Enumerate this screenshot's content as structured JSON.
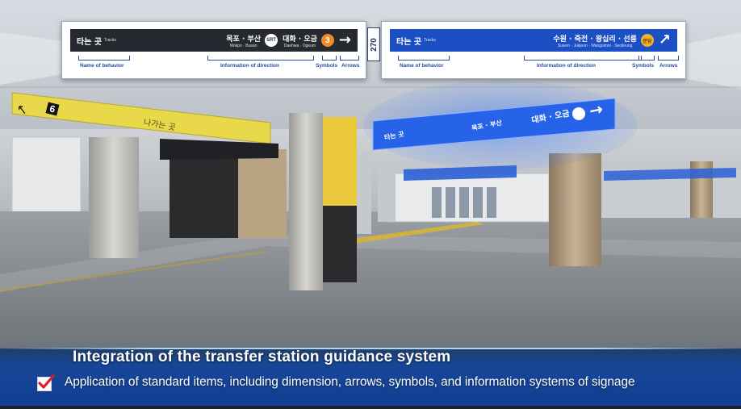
{
  "diagram": {
    "left_sign": {
      "behavior_ko": "타는 곳",
      "behavior_en": "Tracks",
      "destinations": [
        {
          "ko": "목포 · 부산",
          "en": "Mokpo · Busan"
        },
        {
          "ko": "대화 · 오금",
          "en": "Daehwa · Ogeum"
        }
      ],
      "symbols": [
        "SRT",
        "3"
      ],
      "arrow": "→"
    },
    "right_sign": {
      "behavior_ko": "타는 곳",
      "behavior_en": "Tracks",
      "destinations": [
        {
          "ko": "수원 · 죽전 · 왕십리 · 선릉",
          "en": "Suwon · Jukjeon · Wangsimni · Seolleung"
        }
      ],
      "symbols": [
        "분당"
      ],
      "arrow": "↗"
    },
    "side_number": "270",
    "captions": {
      "name_of_behavior": "Name of behavior",
      "information_of_direction": "Information of direction",
      "symbols": "Symbols",
      "arrows": "Arrows"
    }
  },
  "scene_signs": {
    "yellow_number": "6",
    "yellow_text": "나가는 곳",
    "blue_behavior": "타는 곳",
    "blue_dest_1": "목포 · 부산",
    "blue_dest_2": "대화 · 오금",
    "blue_arrow": "→"
  },
  "caption": {
    "title": "Integration of the transfer station guidance system",
    "subtitle": "Application of standard items, including dimension, arrows, symbols, and information systems of signage"
  },
  "colors": {
    "dark_sign": "#262a30",
    "blue_sign": "#1d4fc4",
    "yellow_sign": "#e9d94a",
    "caption_bar": "#123e93",
    "check_mark": "#e0182d"
  }
}
